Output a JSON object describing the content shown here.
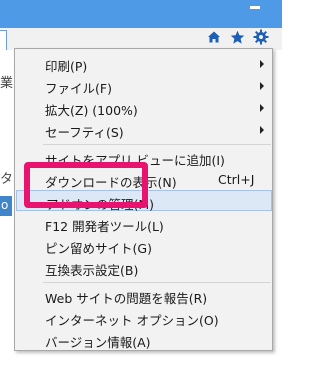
{
  "toolbar": {
    "home_icon": "home-icon",
    "favorites_icon": "star-icon",
    "tools_icon": "gear-icon"
  },
  "page_fragments": [
    "業",
    "タ",
    "o"
  ],
  "menu": {
    "items": [
      {
        "label": "印刷(P)",
        "submenu": true
      },
      {
        "label": "ファイル(F)",
        "submenu": true
      },
      {
        "label": "拡大(Z) (100%)",
        "submenu": true
      },
      {
        "label": "セーフティ(S)",
        "submenu": true
      },
      {
        "label": "サイトをアプリ ビューに追加(I)",
        "submenu": false
      },
      {
        "label": "ダウンロードの表示(N)",
        "shortcut": "Ctrl+J",
        "submenu": false
      },
      {
        "label": "アドオンの管理(M)",
        "submenu": false,
        "highlighted": true
      },
      {
        "label": "F12 開発者ツール(L)",
        "submenu": false
      },
      {
        "label": "ピン留めサイト(G)",
        "submenu": false
      },
      {
        "label": "互換表示設定(B)",
        "submenu": false
      },
      {
        "label": "Web サイトの問題を報告(R)",
        "submenu": false
      },
      {
        "label": "インターネット オプション(O)",
        "submenu": false
      },
      {
        "label": "バージョン情報(A)",
        "submenu": false
      }
    ]
  },
  "colors": {
    "titlebar": "#4f9ae6",
    "toolbar_icon": "#1e5fb4",
    "highlight_bg": "#dde8f7",
    "annotation_box": "#e8136f"
  }
}
